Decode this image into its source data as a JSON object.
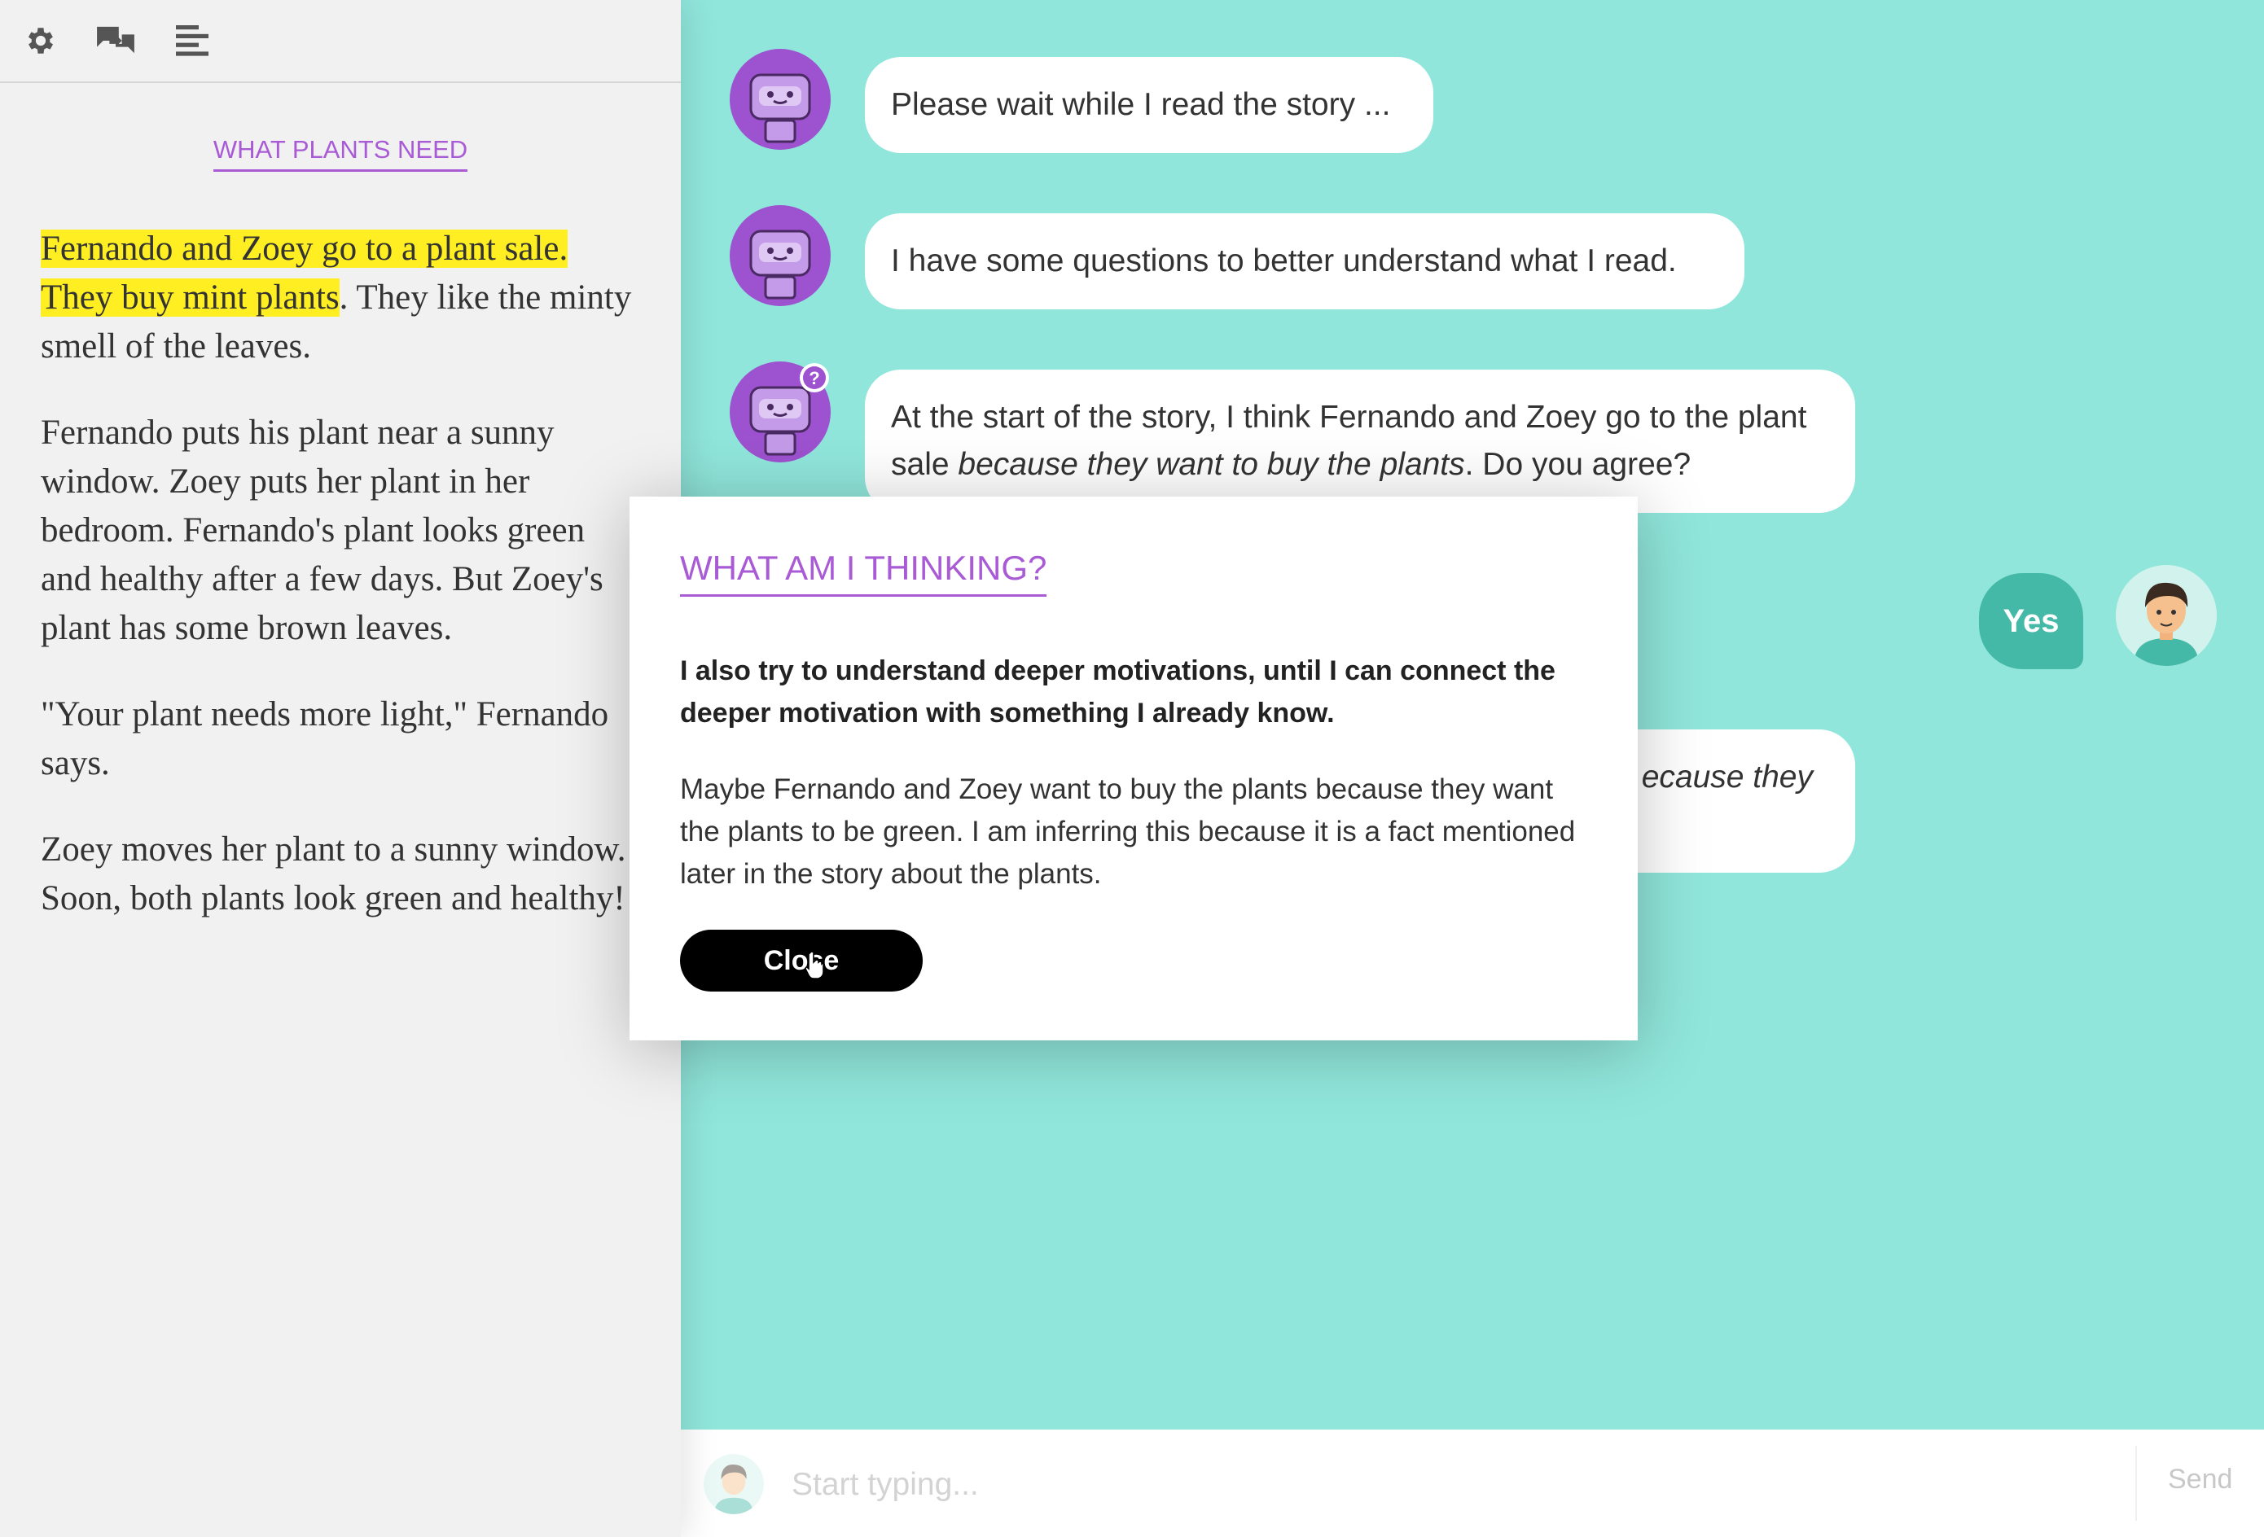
{
  "toolbar": {
    "icons": [
      "gear-icon",
      "chat-icon",
      "text-align-icon"
    ]
  },
  "story": {
    "title": "WHAT PLANTS NEED",
    "p1_hl1": "Fernando and Zoey go to a plant sale.",
    "p1_hl2": "They buy mint plants",
    "p1_rest": ". They like the minty smell of the leaves.",
    "p2": "Fernando puts his plant near a sunny window. Zoey puts her plant in her bedroom. Fernando's plant looks green and healthy after a few days. But Zoey's plant has some brown leaves.",
    "p3": "\"Your plant needs more light,\" Fernando says.",
    "p4": "Zoey moves her plant to a sunny window. Soon, both plants look green and healthy!"
  },
  "chat": {
    "msg1": "Please wait while I read the story ...",
    "msg2": "I have some questions to better understand what I read.",
    "msg3_part1": "At the start of the story, I think Fernando and Zoey go to the plant sale ",
    "msg3_italic": "because they want to buy the plants",
    "msg3_part2": ". Do you agree?",
    "user_reply": "Yes",
    "msg4_partial": "ecause they",
    "badge": "?"
  },
  "modal": {
    "title": "WHAT AM I THINKING?",
    "bold": "I also try to understand deeper motivations, until I can connect the deeper motivation with something I already know.",
    "body": "Maybe Fernando and Zoey want to buy the plants because they want the plants to be green. I am inferring this because it is a fact mentioned later in the story about the plants.",
    "close": "Close"
  },
  "input": {
    "placeholder": "Start typing...",
    "send": "Send"
  },
  "colors": {
    "accent": "#a95bd6",
    "chat_bg": "#90e6db",
    "user_bubble": "#45b9a7",
    "highlight": "#ffee22"
  }
}
